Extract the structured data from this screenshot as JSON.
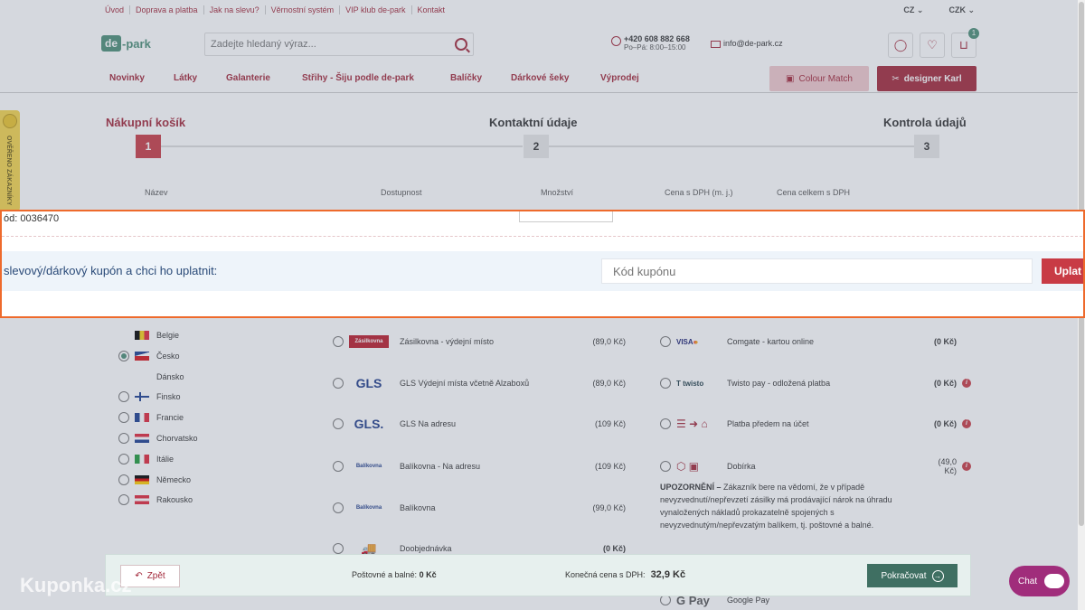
{
  "topbar": {
    "links": [
      "Úvod",
      "Doprava a platba",
      "Jak na slevu?",
      "Věrnostní systém",
      "VIP klub de-park",
      "Kontakt"
    ],
    "lang": "CZ",
    "currency": "CZK"
  },
  "header": {
    "logo_de": "de",
    "logo_park": "-park",
    "search_placeholder": "Zadejte hledaný výraz...",
    "phone": "+420 608 882 668",
    "hours": "Po–Pá: 8:00–15:00",
    "email": "info@de-park.cz",
    "cart_count": "1"
  },
  "nav": {
    "items": [
      "Novinky",
      "Látky",
      "Galanterie",
      "Střihy - Šiju podle de-park",
      "Balíčky",
      "Dárkové šeky",
      "Výprodej"
    ],
    "colour_match": "Colour Match",
    "designer": "designer Karl"
  },
  "side_badge": "OVĚŘENO ZÁKAZNÍKY",
  "steps": [
    {
      "label": "Nákupní košík",
      "num": "1",
      "active": true
    },
    {
      "label": "Kontaktní údaje",
      "num": "2",
      "active": false
    },
    {
      "label": "Kontrola údajů",
      "num": "3",
      "active": false
    }
  ],
  "columns": [
    "Název",
    "Dostupnost",
    "Množství",
    "Cena s DPH (m. j.)",
    "Cena celkem s DPH"
  ],
  "cart_item": {
    "code": "ód: 0036470"
  },
  "coupon": {
    "prompt": "slevový/dárkový kupón a chci ho uplatnit:",
    "placeholder": "Kód kupónu",
    "apply": "Uplat"
  },
  "countries": [
    {
      "name": "Belgie",
      "flag": [
        "#000000",
        "#f7d117",
        "#e0263a"
      ],
      "selected": false,
      "radio": false
    },
    {
      "name": "Česko",
      "flag": "cz",
      "selected": true,
      "radio": true
    },
    {
      "name": "Dánsko",
      "flag": null,
      "selected": false,
      "radio": false
    },
    {
      "name": "Finsko",
      "flag": "fi",
      "selected": false,
      "radio": true
    },
    {
      "name": "Francie",
      "flag": [
        "#1b3d8f",
        "#ffffff",
        "#e0263a"
      ],
      "selected": false,
      "radio": true
    },
    {
      "name": "Chorvatsko",
      "flag": "hr",
      "selected": false,
      "radio": true
    },
    {
      "name": "Itálie",
      "flag": [
        "#1f9a3b",
        "#ffffff",
        "#e0263a"
      ],
      "selected": false,
      "radio": true
    },
    {
      "name": "Německo",
      "flag": "de",
      "selected": false,
      "radio": true
    },
    {
      "name": "Rakousko",
      "flag": "at",
      "selected": false,
      "radio": true
    }
  ],
  "shipping": [
    {
      "logo": "Zásilkovna",
      "name": "Zásilkovna - výdejní místo",
      "price": "(89,0 Kč)"
    },
    {
      "logo": "GLS",
      "name": "GLS Výdejní místa včetně Alzaboxů",
      "price": "(89,0 Kč)"
    },
    {
      "logo": "GLS.",
      "name": "GLS Na adresu",
      "price": "(109 Kč)"
    },
    {
      "logo": "Balíkovna",
      "name": "Balíkovna - Na adresu",
      "price": "(109 Kč)"
    },
    {
      "logo": "Balíkovna",
      "name": "Balíkovna",
      "price": "(99,0 Kč)"
    },
    {
      "logo": "truck-icon",
      "name": "Doobjednávka",
      "price": "(0 Kč)"
    }
  ],
  "payments": [
    {
      "logo": "VISA",
      "name": "Comgate - kartou online",
      "price": "(0 Kč)",
      "info": false
    },
    {
      "logo": "twisto pay",
      "name": "Twisto pay - odložená platba",
      "price": "(0 Kč)",
      "info": true
    },
    {
      "logo": "bank-icon",
      "name": "Platba předem na účet",
      "price": "(0 Kč)",
      "info": true
    },
    {
      "logo": "box-icon",
      "name": "Dobírka",
      "price": "(49,0 Kč)",
      "info": true
    }
  ],
  "gpay": {
    "name": "Google Pay",
    "logo": "G Pay"
  },
  "warning": {
    "title": "UPOZORNĚNÍ –",
    "text": " Zákazník bere na vědomí, že v případě nevyzvednutí/nepřevzetí zásilky má prodávající nárok na úhradu vynaložených nákladů prokazatelně spojených s nevyzvednutým/nepřevzatým balíkem, tj. poštovné a balné."
  },
  "bottom": {
    "back": "Zpět",
    "shipping_label": "Poštovné a balné:",
    "shipping_value": "0 Kč",
    "total_label": "Konečná cena s DPH:",
    "total_value": "32,9 Kč",
    "continue": "Pokračovat"
  },
  "watermark": "Kuponka.cz",
  "chat": "Chat",
  "colors": {
    "brand": "#a2283a",
    "green": "#4b8e77",
    "highlight": "#ee6a2c"
  }
}
